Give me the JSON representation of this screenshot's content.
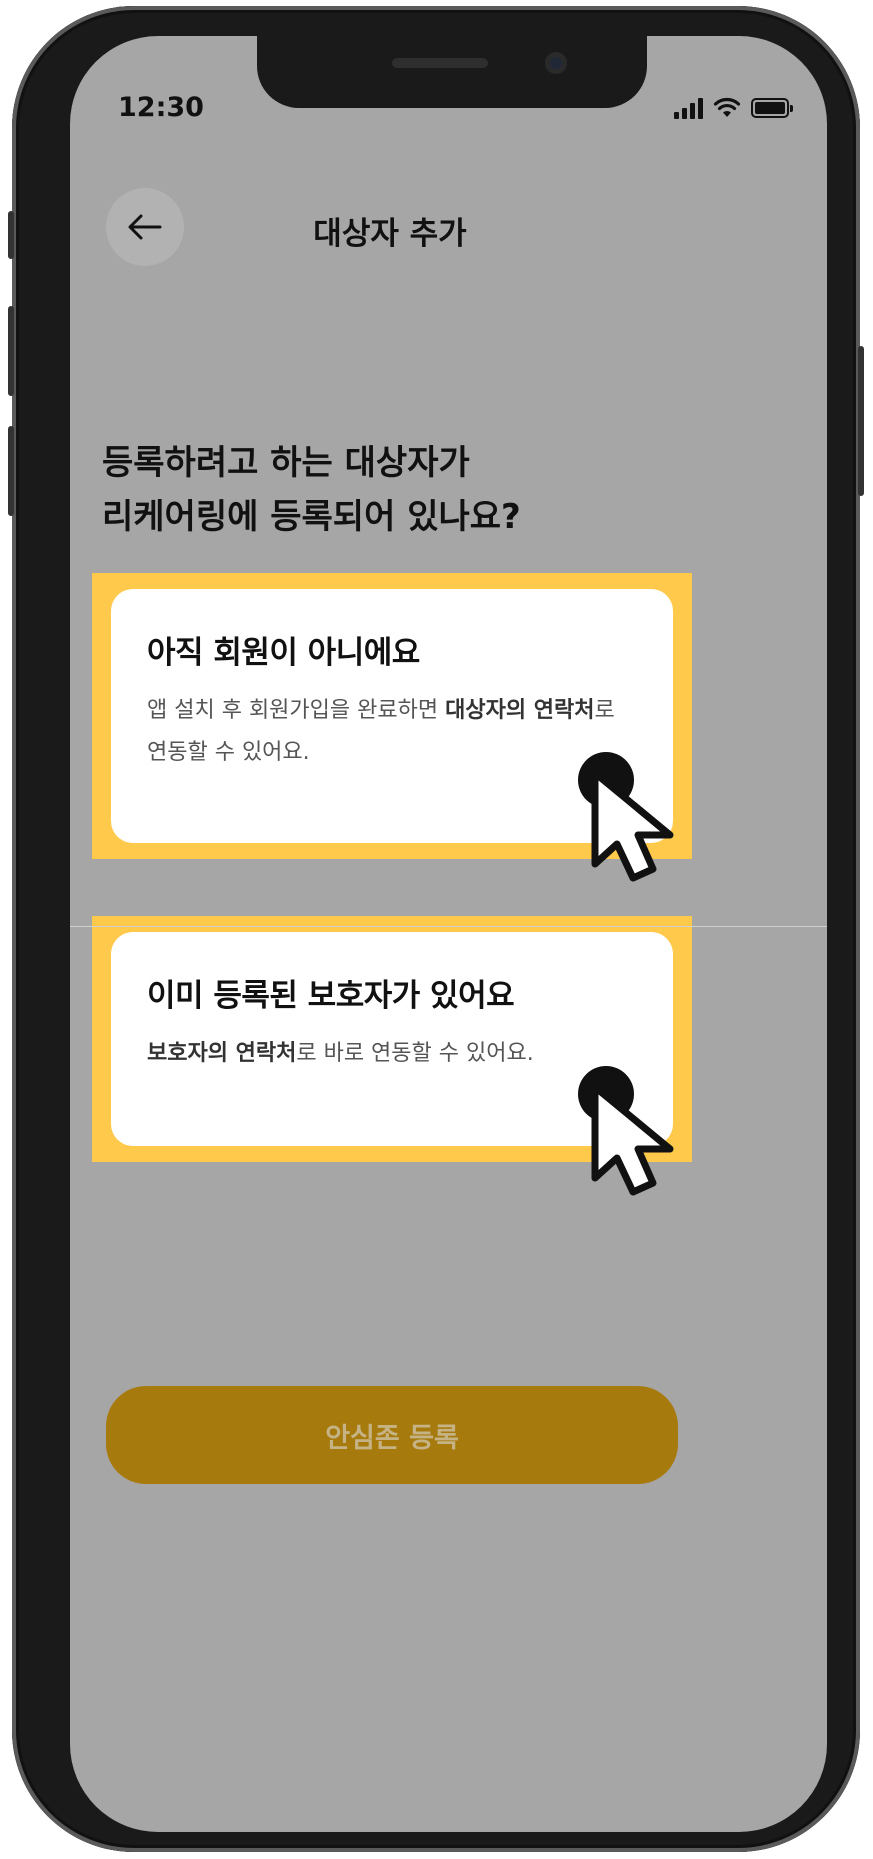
{
  "status_bar": {
    "time": "12:30"
  },
  "header": {
    "title": "대상자 추가",
    "back_icon": "arrow-left-icon"
  },
  "question": "등록하려고 하는 대상자가\n리케어링에 등록되어 있나요?",
  "options": [
    {
      "title": "아직 회원이 아니에요",
      "desc_parts": [
        "앱 설치 후 회원가입을 완료하면 ",
        "대상자의 연락처",
        "로 연동할 수 있어요."
      ]
    },
    {
      "title": "이미 등록된 보호자가 있어요",
      "desc_parts": [
        "",
        "보호자의 연락처",
        "로 바로 연동할 수 있어요."
      ]
    }
  ],
  "cta": {
    "label": "안심존 등록"
  },
  "colors": {
    "highlight": "#ffc94c",
    "cta": "#a77a0d",
    "overlay": "#a6a6a6"
  }
}
